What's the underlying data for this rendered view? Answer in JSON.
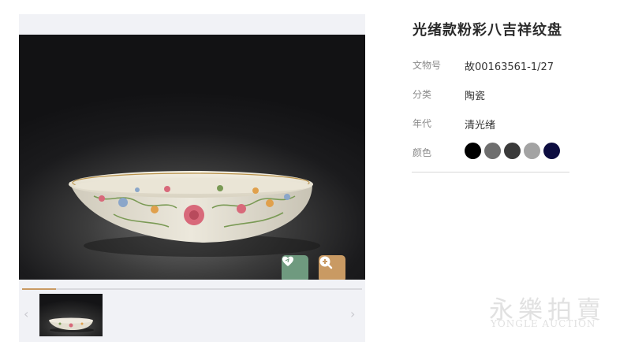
{
  "artifact": {
    "title": "光绪款粉彩八吉祥纹盘",
    "fields": [
      {
        "label": "文物号",
        "value": "故00163561-1/27"
      },
      {
        "label": "分类",
        "value": "陶瓷"
      },
      {
        "label": "年代",
        "value": "清光绪"
      }
    ],
    "color_label": "颜色",
    "colors": [
      "#000000",
      "#6e6e6e",
      "#3a3a3a",
      "#a3a3a3",
      "#0d0d40"
    ]
  },
  "viewer": {
    "progress_fraction": 0.1,
    "favorite_icon": "heart-icon",
    "zoom_icon": "zoom-in-icon",
    "prev_arrow": "‹",
    "next_arrow": "›"
  },
  "watermark": {
    "chinese": "永樂拍賣",
    "english": "YONGLE AUCTION"
  }
}
